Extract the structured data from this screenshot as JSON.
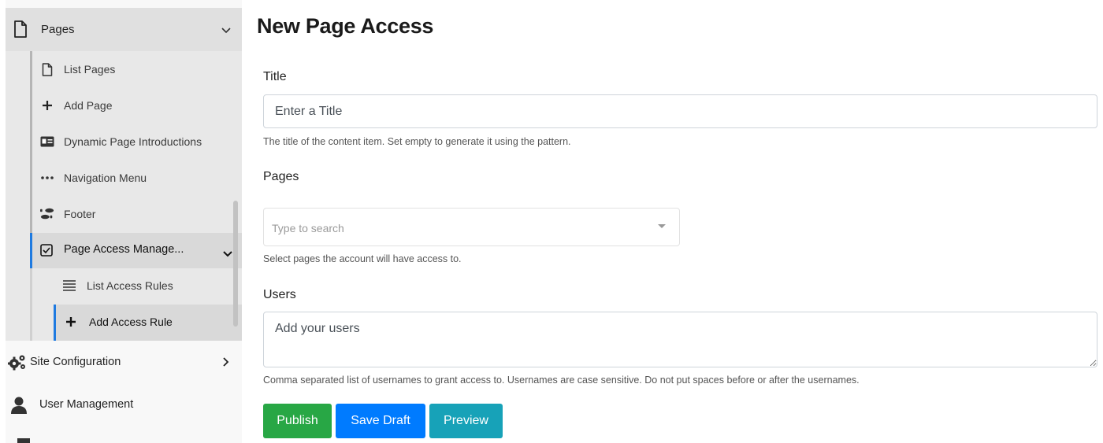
{
  "sidebar": {
    "pages_label": "Pages",
    "items": [
      {
        "label": "List Pages",
        "icon": "file-icon"
      },
      {
        "label": "Add Page",
        "icon": "plus-icon"
      },
      {
        "label": "Dynamic Page Introductions",
        "icon": "id-card-icon"
      },
      {
        "label": "Navigation Menu",
        "icon": "ellipsis-icon"
      },
      {
        "label": "Footer",
        "icon": "shoe-prints-icon"
      }
    ],
    "group": {
      "label": "Page Access Manage...",
      "icon": "check-square-icon"
    },
    "group_items": [
      {
        "label": "List Access Rules",
        "icon": "list-icon"
      },
      {
        "label": "Add Access Rule",
        "icon": "plus-icon",
        "active": true
      }
    ],
    "site_config_label": "Site Configuration",
    "user_mgmt_label": "User Management"
  },
  "main": {
    "title": "New Page Access",
    "title_field": {
      "label": "Title",
      "placeholder": "Enter a Title",
      "hint": "The title of the content item. Set empty to generate it using the pattern."
    },
    "pages_field": {
      "label": "Pages",
      "placeholder": "Type to search",
      "hint": "Select pages the account will have access to."
    },
    "users_field": {
      "label": "Users",
      "placeholder": "Add your users",
      "hint": "Comma separated list of usernames to grant access to. Usernames are case sensitive. Do not put spaces before or after the usernames."
    },
    "buttons": {
      "publish": "Publish",
      "save_draft": "Save Draft",
      "preview": "Preview"
    }
  },
  "colors": {
    "active_accent": "#1e7ae0",
    "publish": "#28a745",
    "save_draft": "#007bff",
    "preview": "#17a2b8"
  }
}
